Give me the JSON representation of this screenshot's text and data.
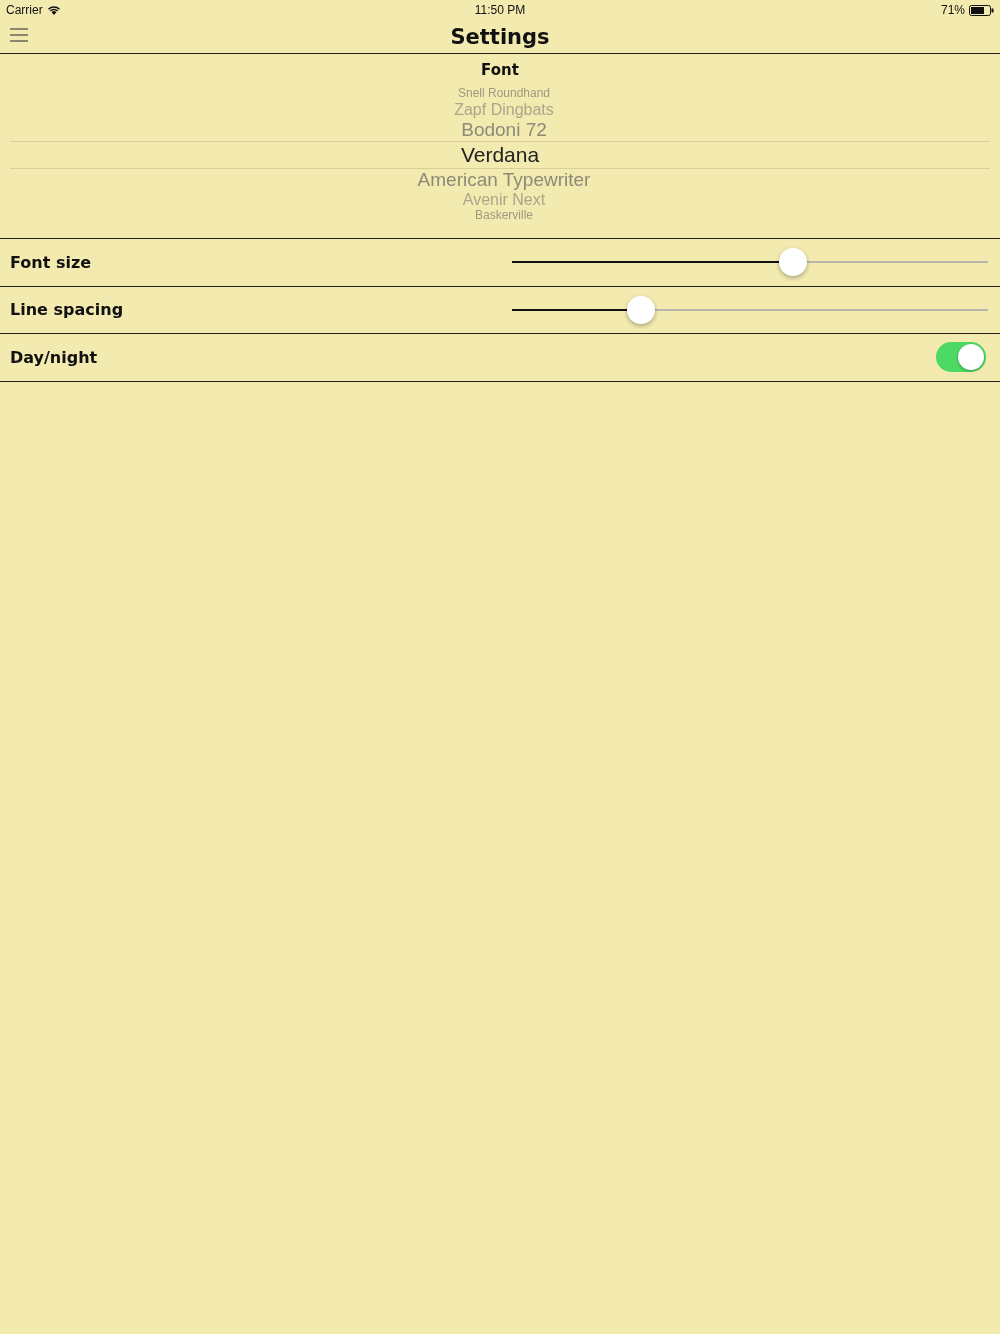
{
  "status_bar": {
    "carrier": "Carrier",
    "time": "11:50 PM",
    "battery": "71%"
  },
  "nav": {
    "title": "Settings"
  },
  "font_picker": {
    "label": "Font",
    "items": [
      {
        "name": "Snell Roundhand",
        "selected": false
      },
      {
        "name": "Zapf Dingbats",
        "selected": false
      },
      {
        "name": "Bodoni 72",
        "selected": false
      },
      {
        "name": "Verdana",
        "selected": true
      },
      {
        "name": "American Typewriter",
        "selected": false
      },
      {
        "name": "Avenir Next",
        "selected": false
      },
      {
        "name": "Baskerville",
        "selected": false
      }
    ]
  },
  "rows": [
    {
      "kind": "slider",
      "label": "Font size",
      "level": 0.59
    },
    {
      "kind": "slider",
      "label": "Line spacing",
      "level": 0.27
    },
    {
      "kind": "switch",
      "label": "Day/night",
      "on": true
    }
  ]
}
